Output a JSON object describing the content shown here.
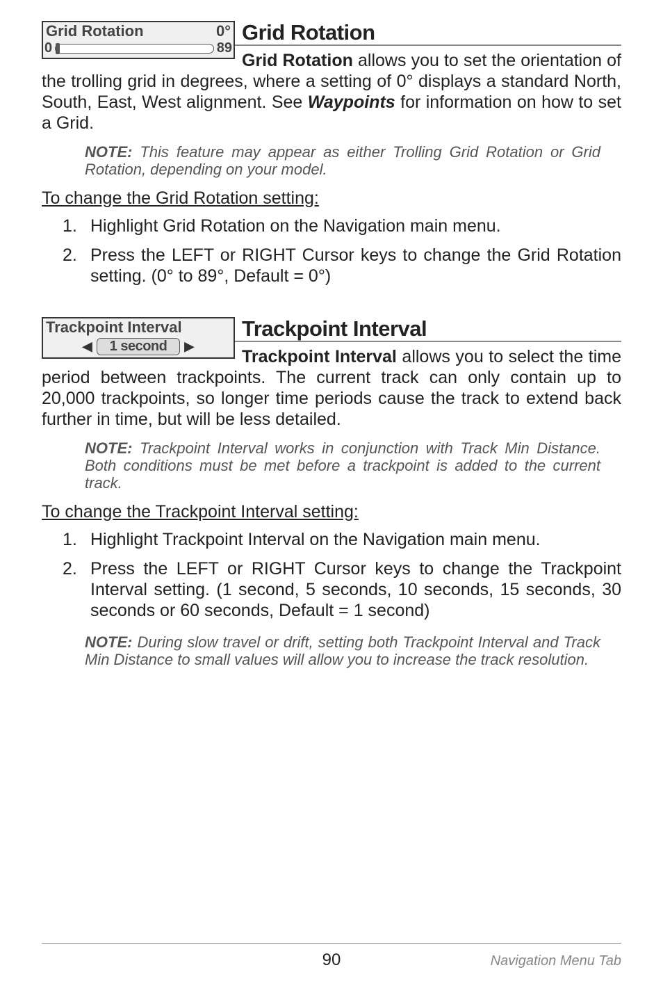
{
  "grid_rotation": {
    "inset_title": "Grid Rotation",
    "inset_value": "0°",
    "slider_min": "0",
    "slider_max": "89",
    "heading": "Grid Rotation",
    "lead_bold": "Grid Rotation",
    "lead_rest_1": " allows you to set the orientation of the trolling grid in degrees, where a setting of 0° displays a standard North, South, East, West alignment. See ",
    "lead_italic": "Waypoints",
    "lead_rest_2": " for information on how to set a Grid.",
    "note_label": "NOTE:",
    "note_text": " This feature may appear as either Trolling Grid Rotation or Grid Rotation, depending on your model.",
    "proc_heading": "To change the Grid Rotation setting:",
    "steps": [
      "Highlight Grid Rotation on the Navigation main menu.",
      "Press the LEFT or RIGHT Cursor keys to change the Grid Rotation setting. (0° to 89°, Default = 0°)"
    ]
  },
  "trackpoint": {
    "inset_title": "Trackpoint Interval",
    "select_value": "1 second",
    "heading": "Trackpoint Interval",
    "lead_bold": "Trackpoint Interval",
    "lead_rest": " allows you to select the time period between trackpoints. The current track can only contain up to 20,000 trackpoints, so longer time periods cause the track to extend back further in time, but will be less detailed.",
    "note1_label": "NOTE:",
    "note1_text": " Trackpoint Interval works in conjunction with Track Min Distance. Both conditions must be met before a trackpoint is added to the current track.",
    "proc_heading": "To change the Trackpoint Interval setting:",
    "steps": [
      "Highlight Trackpoint Interval on the Navigation main menu.",
      "Press the LEFT or RIGHT Cursor keys to change the Trackpoint Interval setting. (1 second, 5 seconds, 10 seconds, 15 seconds, 30 seconds or 60 seconds, Default = 1 second)"
    ],
    "note2_label": "NOTE:",
    "note2_text": " During slow travel or drift, setting both Trackpoint Interval and Track Min Distance to small values will allow you to increase the track resolution."
  },
  "footer": {
    "page": "90",
    "tab": "Navigation Menu Tab"
  }
}
